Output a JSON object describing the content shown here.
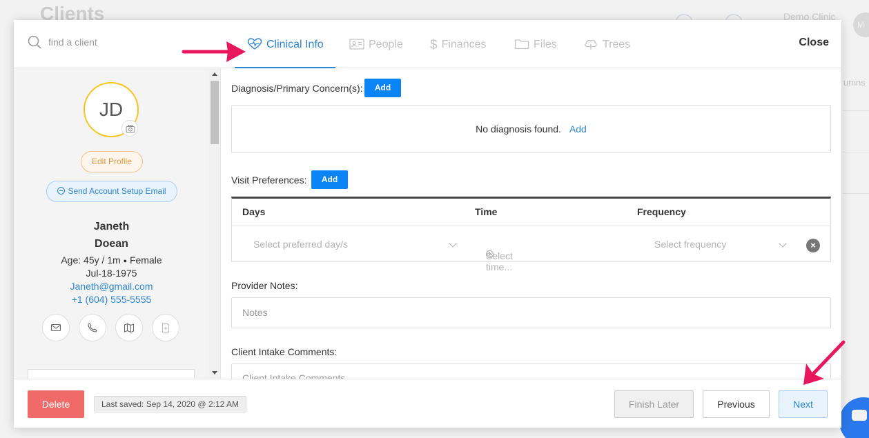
{
  "background": {
    "title": "Clients",
    "clinic": "Demo Clinic",
    "avatar_initials": "M",
    "columns_fragment": "umns"
  },
  "search": {
    "placeholder": "find a client"
  },
  "client": {
    "initials": "JD",
    "edit_profile_label": "Edit Profile",
    "send_setup_email_label": "Send Account Setup Email",
    "first_name": "Janeth",
    "last_name": "Doean",
    "age_prefix": "Age: 45y / 1m",
    "gender": "Female",
    "dob": "Jul-18-1975",
    "email": "Janeth@gmail.com",
    "phone": "+1 (604) 555-5555"
  },
  "tabs": [
    {
      "label": "Clinical Info",
      "icon": "heartbeat-icon",
      "active": true
    },
    {
      "label": "People",
      "icon": "id-card-icon",
      "active": false
    },
    {
      "label": "Finances",
      "icon": "dollar-icon",
      "active": false
    },
    {
      "label": "Files",
      "icon": "folder-icon",
      "active": false
    },
    {
      "label": "Trees",
      "icon": "tree-icon",
      "active": false
    }
  ],
  "close_label": "Close",
  "diagnosis": {
    "label": "Diagnosis/Primary Concern(s):",
    "add_label": "Add",
    "empty_text": "No diagnosis found.",
    "empty_link": "Add"
  },
  "visit_preferences": {
    "label": "Visit Preferences:",
    "add_label": "Add",
    "columns": [
      "Days",
      "Time",
      "Frequency"
    ],
    "row": {
      "days_placeholder": "Select preferred day/s",
      "time_placeholder": "Select time...",
      "frequency_placeholder": "Select frequency"
    }
  },
  "provider_notes": {
    "label": "Provider Notes:",
    "placeholder": "Notes"
  },
  "intake_comments": {
    "label": "Client Intake Comments:",
    "placeholder": "Client Intake Comments"
  },
  "footer": {
    "delete_label": "Delete",
    "last_saved": "Last saved: Sep 14, 2020 @ 2:12 AM",
    "finish_later_label": "Finish Later",
    "previous_label": "Previous",
    "next_label": "Next"
  },
  "colors": {
    "accent": "#2d85d5",
    "primary_button": "#0b84f5",
    "danger": "#f06a6a",
    "avatar_ring": "#f5c518",
    "annotation_arrow": "#e8175d"
  }
}
